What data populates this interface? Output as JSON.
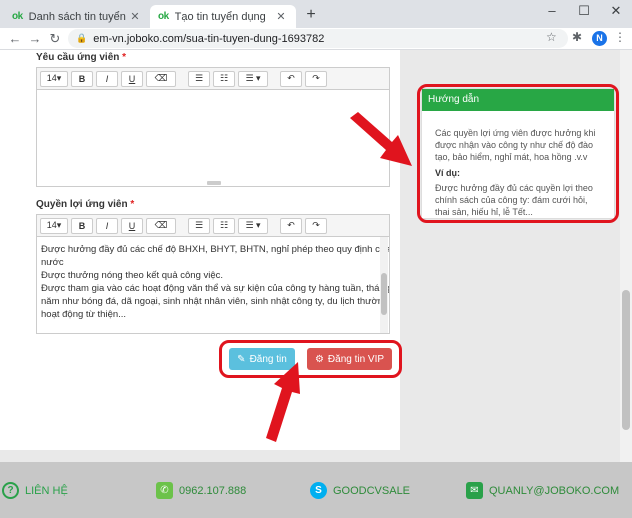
{
  "browser": {
    "tabs": [
      {
        "title": "Danh sách tin tuyển dụng",
        "favicon": "ok"
      },
      {
        "title": "Tạo tin tuyển dụng",
        "favicon": "ok"
      }
    ],
    "url": "em-vn.joboko.com/sua-tin-tuyen-dung-1693782",
    "profile_initial": "N"
  },
  "editor_toolbar": {
    "font_size": "14▾",
    "bold": "B",
    "italic": "I",
    "underline": "U",
    "eraser": "⌫",
    "bullets": "☰",
    "numbers": "☷",
    "align": "☰ ▾",
    "undo": "↶",
    "redo": "↷"
  },
  "form": {
    "requirements_label": "Yêu cầu ứng viên",
    "benefits_label": "Quyền lợi ứng viên",
    "required_mark": "*",
    "benefits_lines": [
      "Được hưởng đầy đủ các chế độ BHXH, BHYT, BHTN, nghỉ phép theo quy định của nhà",
      "nước",
      "Được thưởng nóng theo kết quả công việc.",
      "Được tham gia vào các hoạt động văn thể và sự kiện của công ty hàng tuần, tháng, quý,",
      "năm như bóng đá, dã ngoại, sinh nhật nhân viên, sinh nhật công ty, du lịch thường niên,",
      "hoạt động từ thiện..."
    ],
    "post_button": "Đăng tin",
    "vip_button": "Đăng tin VIP"
  },
  "guide": {
    "title": "Hướng dẫn",
    "text": "Các quyền lợi ứng viên được hưởng khi được nhận vào công ty như chế độ đào tạo, bảo hiểm, nghỉ mát, hoa hồng .v.v",
    "example_label": "Ví dụ:",
    "example_text": "Được hưởng đầy đủ các quyền lợi theo chính sách của công ty: đám cưới hỏi, thai sản, hiếu hỉ, lễ Tết..."
  },
  "footer": {
    "help": "LIÊN HỆ",
    "phone": "0962.107.888",
    "skype": "GOODCVSALE",
    "email": "QUANLY@JOBOKO.COM"
  },
  "colors": {
    "accent_green": "#28a745",
    "post_blue": "#5bc0de",
    "vip_red": "#d9534f",
    "annotation_red": "#e0141e"
  }
}
